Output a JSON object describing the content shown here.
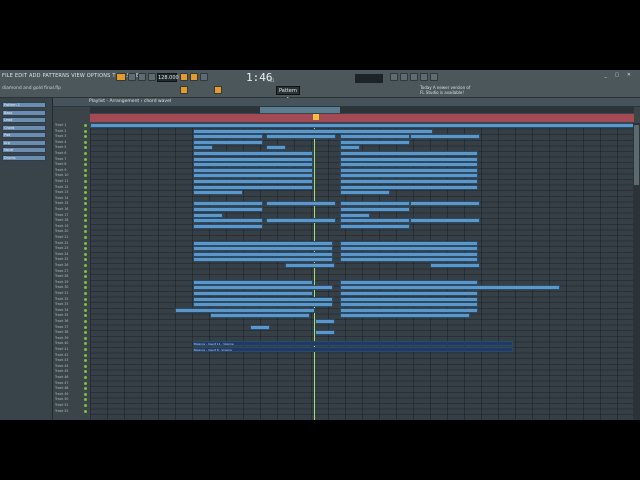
{
  "menu": {
    "text": "FILE EDIT ADD PATTERNS VIEW OPTIONS TOOLS HELP"
  },
  "hint": {
    "text": "diamond and gold final.flp"
  },
  "transport": {
    "tempo": "128.000",
    "time": "1:46",
    "time_sub": ":61",
    "pattern": "Pattern 1"
  },
  "news": {
    "line1": "Today  A newer version of",
    "line2": "FL Studio is available!"
  },
  "playlist": {
    "title": "Playlist - Arrangement › chord wavel"
  },
  "panel": {
    "items": [
      "Pattern 1",
      "Bass",
      "Lead",
      "Chord",
      "Pad",
      "Arp",
      "Vocal",
      "Drums"
    ]
  },
  "tracks": [
    "Track 1",
    "Track 2",
    "Track 3",
    "Track 4",
    "Track 5",
    "Track 6",
    "Track 7",
    "Track 8",
    "Track 9",
    "Track 10",
    "Track 11",
    "Track 12",
    "Track 13",
    "Track 14",
    "Track 15",
    "Track 16",
    "Track 17",
    "Track 18",
    "Track 19",
    "Track 20",
    "Track 21",
    "Track 22",
    "Track 23",
    "Track 24",
    "Track 25",
    "Track 26",
    "Track 27",
    "Track 28",
    "Track 29",
    "Track 30",
    "Track 31",
    "Track 32",
    "Track 33",
    "Track 34",
    "Track 35",
    "Track 36",
    "Track 37",
    "Track 38",
    "Track 39",
    "Track 40",
    "Track 41",
    "Track 42",
    "Track 43",
    "Track 44",
    "Track 45",
    "Track 46",
    "Track 47",
    "Track 48",
    "Track 49",
    "Track 50",
    "Track 51",
    "Track 52"
  ],
  "clips": {
    "automation_1": "Balance - Insert 11 - Volume",
    "automation_2": "Balance - Insert 8 - Volume"
  },
  "colors": {
    "accent": "#e49b2c",
    "clip": "#5b97c9",
    "ruler": "#a34a55",
    "playhead": "#9ee06b"
  }
}
